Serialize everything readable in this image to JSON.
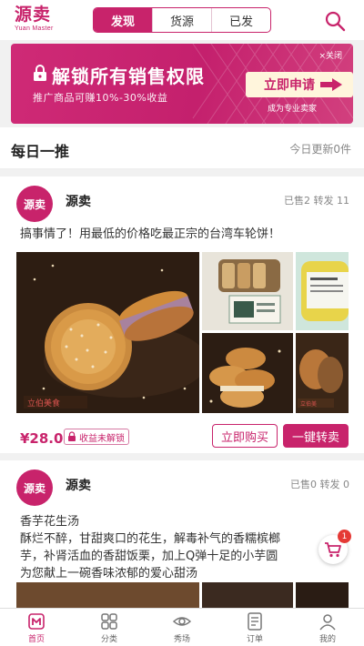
{
  "header": {
    "logo_text": "源卖",
    "logo_sub": "Yuan Master",
    "tabs": [
      {
        "label": "发现",
        "active": true
      },
      {
        "label": "货源",
        "active": false
      },
      {
        "label": "已发",
        "active": false
      }
    ],
    "search_icon": "search-icon"
  },
  "banner": {
    "close_label": "×关闭",
    "title": "解锁所有销售权限",
    "desc": "推广商品可赚10%-30%收益",
    "cta_label": "立即申请",
    "note": "成为专业卖家"
  },
  "section": {
    "title": "每日一推",
    "update": "今日更新0件"
  },
  "posts": [
    {
      "avatar_text": "源卖",
      "shop_name": "源卖",
      "stats": "已售2  转发 11",
      "text": "搞事情了！用最低的价格吃最正宗的台湾车轮饼！",
      "price": "¥28.0",
      "lock_label": "收益未解锁",
      "buy_label": "立即购买",
      "resell_label": "一键转卖"
    },
    {
      "avatar_text": "源卖",
      "shop_name": "源卖",
      "stats": "已售0  转发 0",
      "text_lines": [
        "香芋花生汤",
        "酥烂不醉，甘甜爽口的花生，解毒补气的香糯槟榔",
        "芋，补肾活血的香甜饭栗，加上Q弹十足的小芋圆",
        "为您献上一碗香味浓郁的爱心甜汤"
      ]
    }
  ],
  "cart": {
    "badge": "1"
  },
  "tabbar": [
    {
      "label": "首页",
      "icon": "home-icon",
      "active": true
    },
    {
      "label": "分类",
      "icon": "category-icon",
      "active": false
    },
    {
      "label": "秀场",
      "icon": "eye-icon",
      "active": false
    },
    {
      "label": "订单",
      "icon": "order-icon",
      "active": false
    },
    {
      "label": "我的",
      "icon": "user-icon",
      "active": false
    }
  ],
  "colors": {
    "brand": "#c8236b",
    "banner": "#c4206d",
    "cta_bg": "#fff5dc",
    "badge": "#e53935"
  }
}
